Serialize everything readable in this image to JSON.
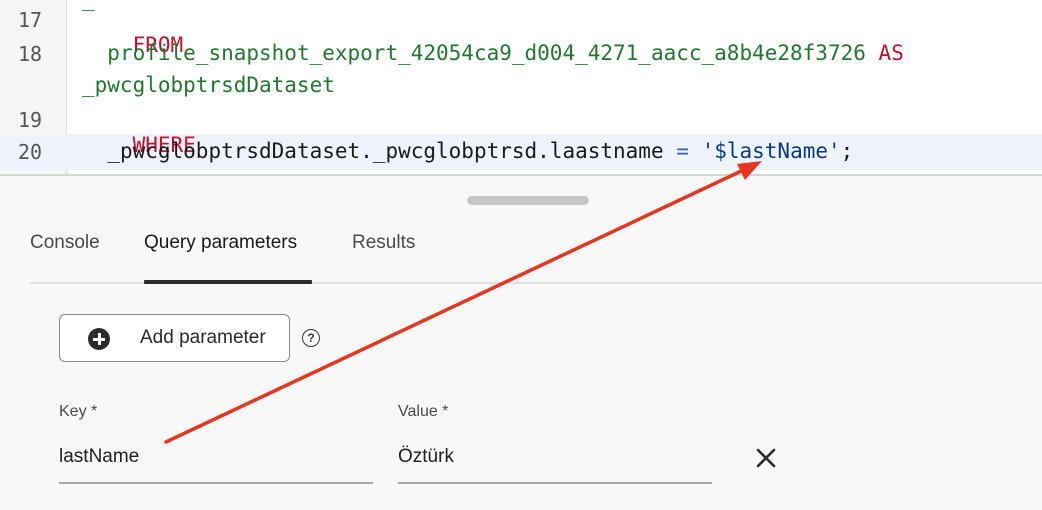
{
  "editor": {
    "lines": [
      {
        "number": "17",
        "keyword": "FROM"
      },
      {
        "number": "18",
        "table": "profile_snapshot_export_42054ca9_d004_4271_aacc_a8b4e28f3726",
        "alias_keyword": "AS",
        "alias": "_pwcglobptrsdDataset"
      },
      {
        "number": "19",
        "keyword": "WHERE"
      },
      {
        "number": "20",
        "left": "_pwcglobptrsdDataset._pwcglobptrsd.laastname",
        "operator": "=",
        "value": "'$lastName'",
        "terminator": ";"
      }
    ]
  },
  "panel": {
    "tabs": [
      {
        "label": "Console"
      },
      {
        "label": "Query parameters",
        "active": true
      },
      {
        "label": "Results"
      }
    ],
    "add_parameter_label": "Add parameter",
    "help_glyph": "?",
    "key_label": "Key *",
    "value_label": "Value *",
    "parameter": {
      "key": "lastName",
      "value": "Öztürk"
    }
  },
  "icons": {
    "add": "plus-circle-icon",
    "help": "help-icon",
    "remove": "close-icon"
  },
  "colors": {
    "keyword": "#c8102e",
    "identifier": "#1f7a2c",
    "string": "#0b3a8a",
    "annotation_arrow": "#e8361e"
  }
}
